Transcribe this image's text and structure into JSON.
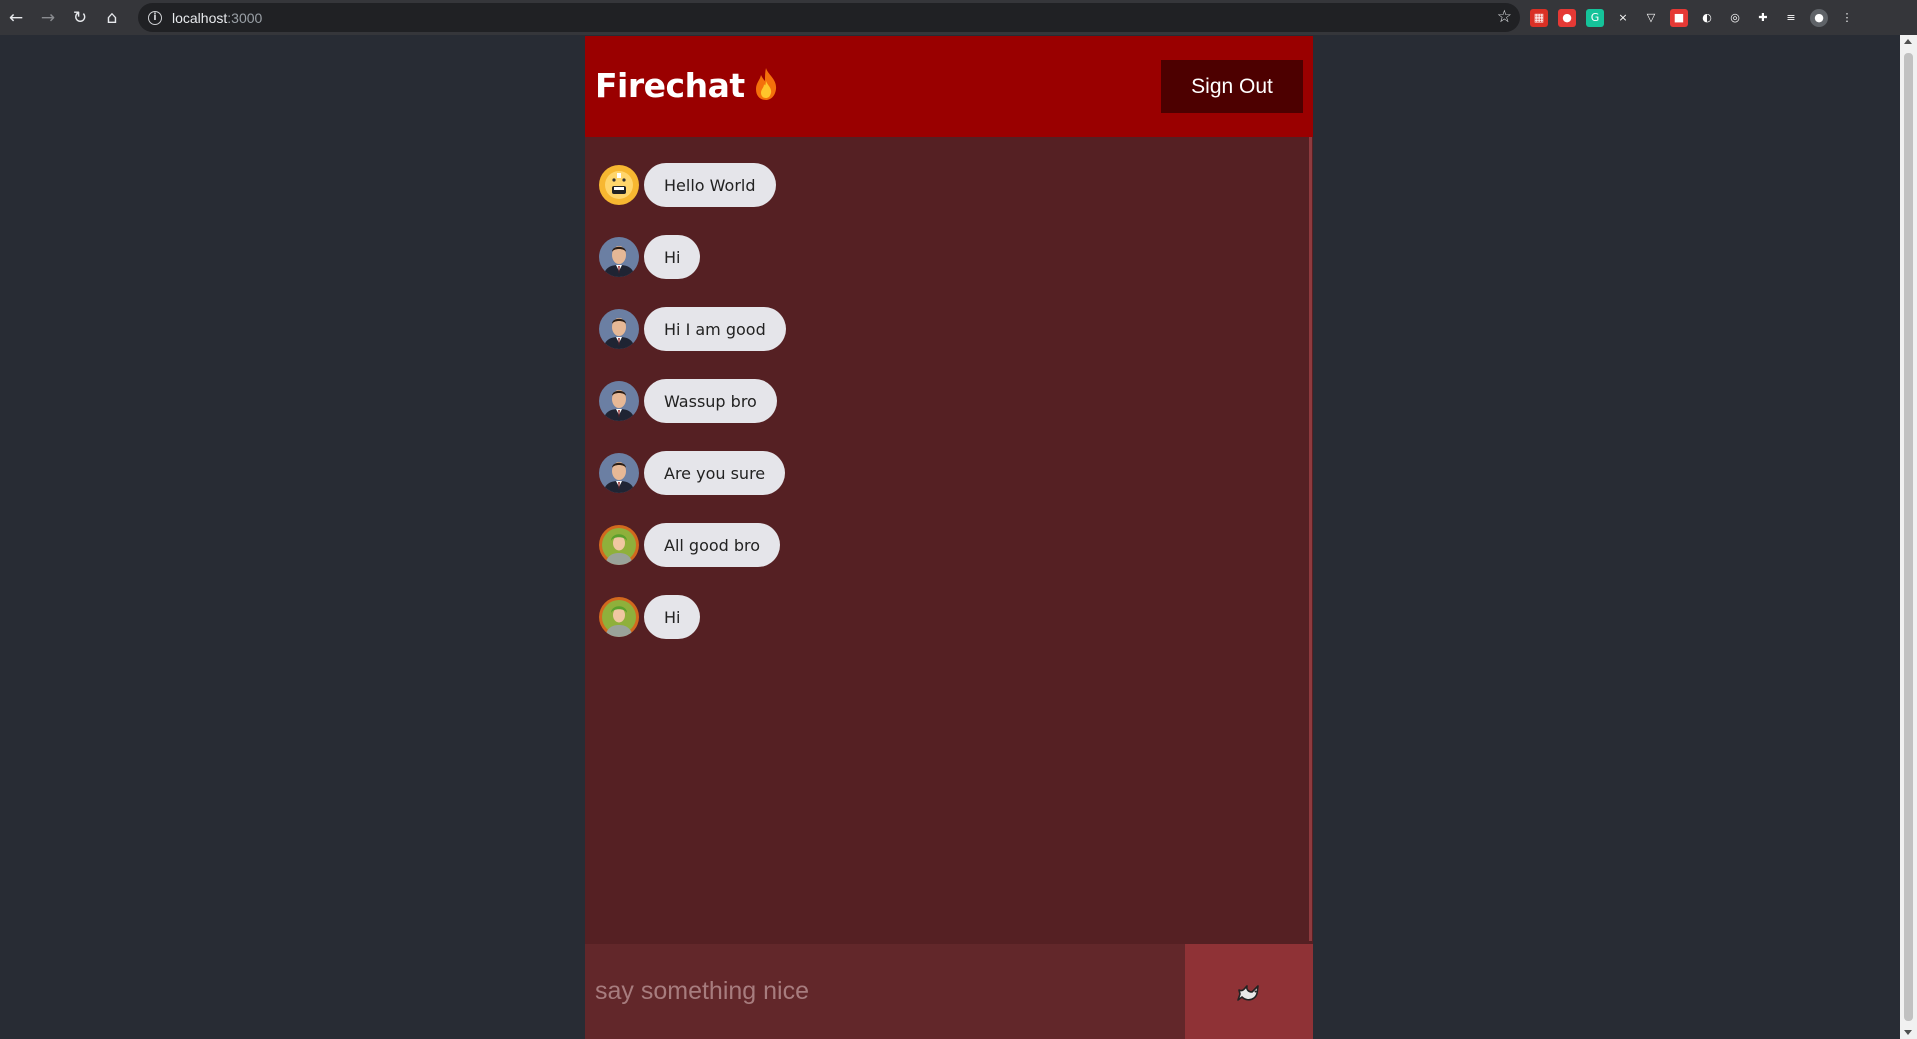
{
  "browser": {
    "url_host": "localhost",
    "url_port": ":3000",
    "extensions": [
      {
        "name": "calendar-ext-icon",
        "color": "#d93025",
        "glyph": "▦"
      },
      {
        "name": "ext-red-icon",
        "color": "#e53935",
        "glyph": "●"
      },
      {
        "name": "grammarly-icon",
        "color": "#15c39a",
        "glyph": "G"
      },
      {
        "name": "ext-x-icon",
        "color": "#35363a",
        "glyph": "×"
      },
      {
        "name": "pocket-icon",
        "color": "#35363a",
        "glyph": "▽"
      },
      {
        "name": "ext-gift-icon",
        "color": "#e53935",
        "glyph": "■"
      },
      {
        "name": "dark-mode-icon",
        "color": "#35363a",
        "glyph": "◐"
      },
      {
        "name": "ext-target-icon",
        "color": "#35363a",
        "glyph": "◎"
      },
      {
        "name": "extensions-puzzle-icon",
        "color": "#35363a",
        "glyph": "✚"
      },
      {
        "name": "reading-list-icon",
        "color": "#35363a",
        "glyph": "≡"
      },
      {
        "name": "profile-avatar-icon",
        "color": "#5f6368",
        "glyph": "●"
      },
      {
        "name": "menu-kebab-icon",
        "color": "#35363a",
        "glyph": "⋮"
      }
    ]
  },
  "app": {
    "title": "Firechat",
    "sign_out_label": "Sign Out",
    "composer_placeholder": "say something nice",
    "header_color": "#9a0000",
    "body_color": "#552023"
  },
  "messages": [
    {
      "text": "Hello World",
      "avatar": "yellow"
    },
    {
      "text": "Hi",
      "avatar": "man"
    },
    {
      "text": "Hi I am good",
      "avatar": "man"
    },
    {
      "text": "Wassup bro",
      "avatar": "man"
    },
    {
      "text": "Are you sure",
      "avatar": "man"
    },
    {
      "text": "All good bro",
      "avatar": "green"
    },
    {
      "text": "Hi",
      "avatar": "green"
    }
  ]
}
